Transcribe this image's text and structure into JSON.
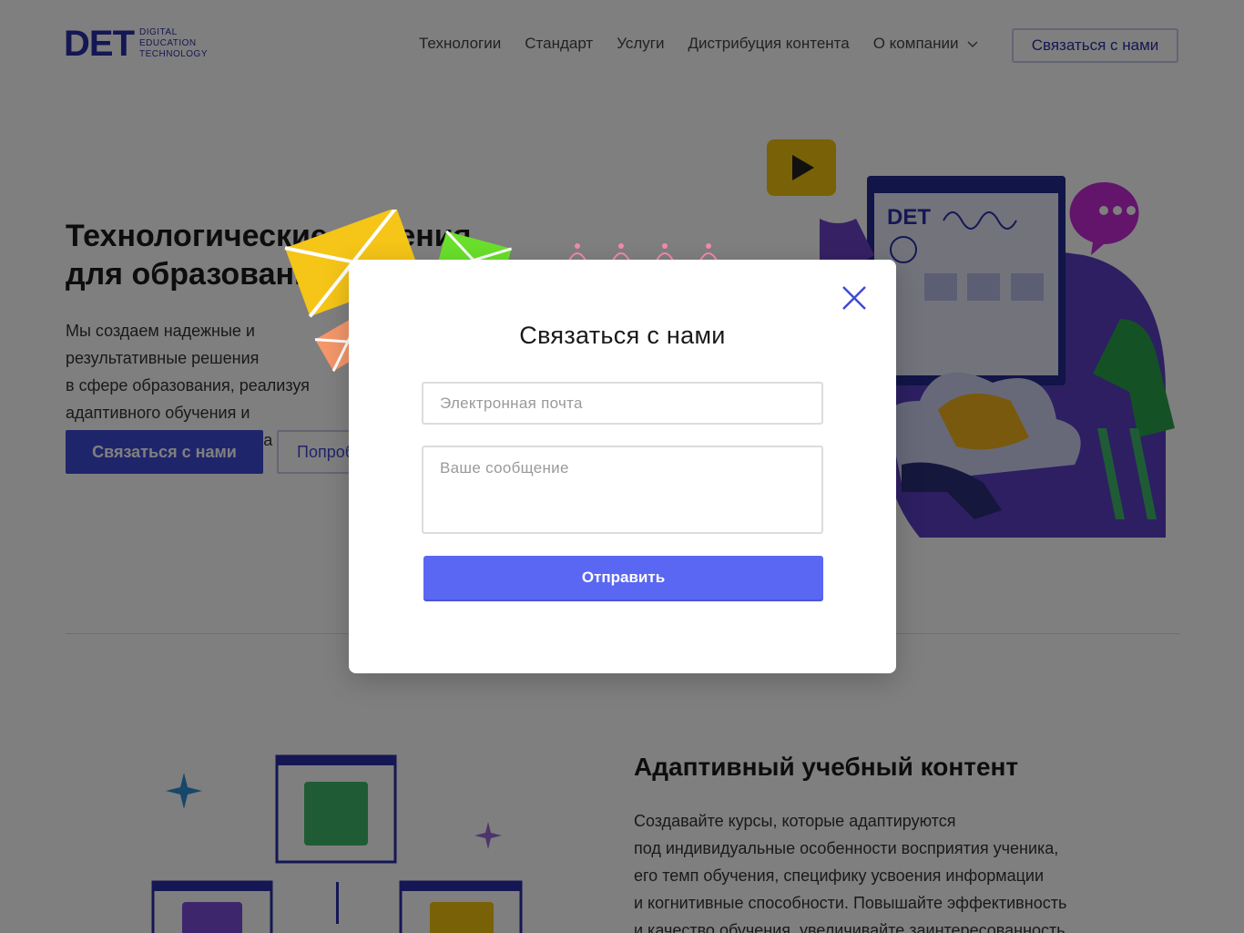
{
  "logo": {
    "mark": "DET",
    "line1": "DIGITAL",
    "line2": "EDUCATION",
    "line3": "TECHNOLOGY"
  },
  "nav": {
    "items": [
      "Технологии",
      "Стандарт",
      "Услуги",
      "Дистрибуция контента"
    ],
    "dropdown_label": "О компании",
    "cta_label": "Связаться с нами"
  },
  "hero": {
    "title": "Технологические решения для образования",
    "text": "Мы создаем надежные и результативные решения\nв сфере образования, реализуя\nадаптивного обучения и искусственного интеллекта",
    "primary_button": "Связаться с нами",
    "secondary_button": "Попробовать"
  },
  "illustration": {
    "screen_logo": "DET"
  },
  "section": {
    "title": "Адаптивный учебный контент",
    "text": "Создавайте курсы, которые адаптируются\nпод индивидуальные особенности восприятия ученика,\nего темп обучения, специфику усвоения информации\nи когнитивные способности. Повышайте эффективность\nи качество обучения, увеличивайте заинтересованность"
  },
  "modal": {
    "title": "Связаться с нами",
    "email_placeholder": "Электронная почта",
    "message_placeholder": "Ваше сообщение",
    "submit_label": "Отправить"
  },
  "colors": {
    "brand": "#2a2fa8",
    "primary_button": "#3f4ad6",
    "submit_button": "#5a67f2",
    "overlay": "rgba(0,0,0,0.5)"
  }
}
